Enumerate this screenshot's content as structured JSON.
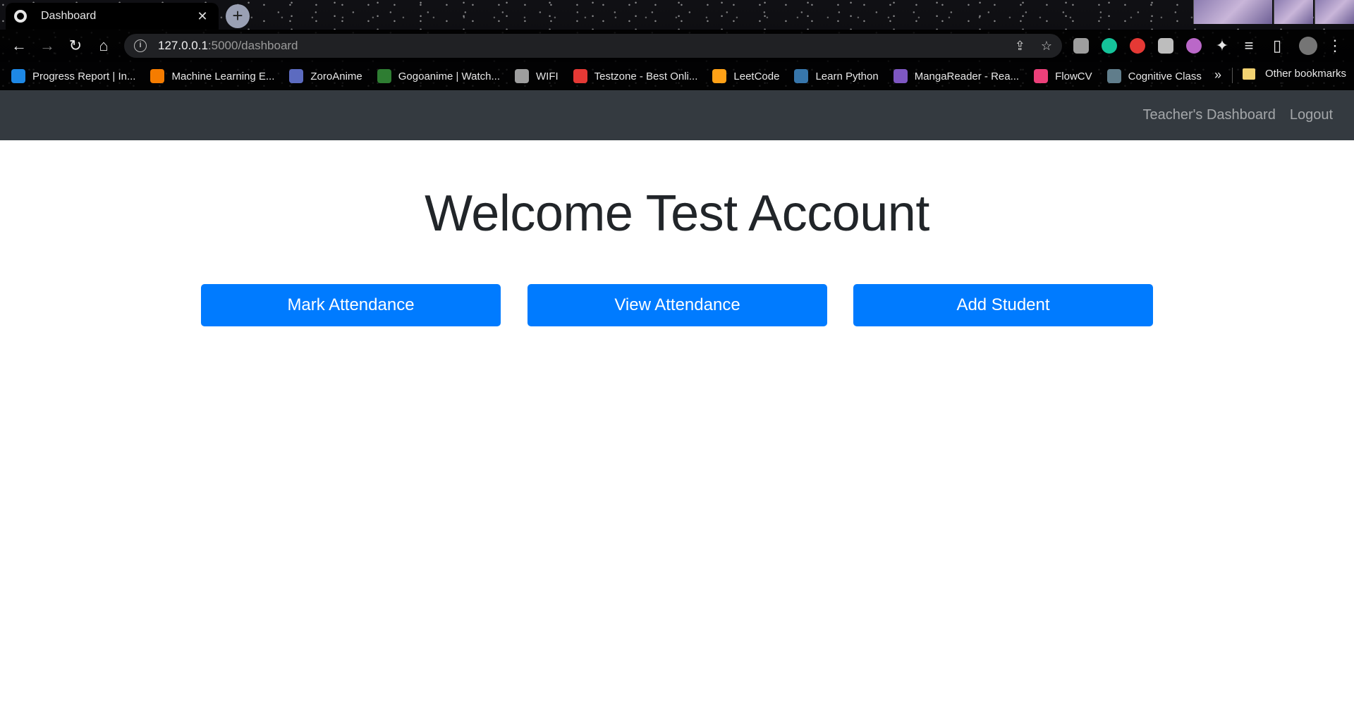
{
  "browser": {
    "tab_title": "Dashboard",
    "url_host": "127.0.0.1",
    "url_rest": ":5000/dashboard",
    "bookmarks": [
      {
        "label": "Progress Report | In...",
        "icon": "is-icon",
        "color": "#1e88e5"
      },
      {
        "label": "Machine Learning E...",
        "icon": "hexagon-icon",
        "color": "#f57c00"
      },
      {
        "label": "ZoroAnime",
        "icon": "zoro-icon",
        "color": "#5c6bc0"
      },
      {
        "label": "Gogoanime | Watch...",
        "icon": "gogo-icon",
        "color": "#2e7d32"
      },
      {
        "label": "WIFI",
        "icon": "globe-icon",
        "color": "#9e9e9e"
      },
      {
        "label": "Testzone - Best Onli...",
        "icon": "bug-icon",
        "color": "#e53935"
      },
      {
        "label": "LeetCode",
        "icon": "leetcode-icon",
        "color": "#ffa116"
      },
      {
        "label": "Learn Python",
        "icon": "python-icon",
        "color": "#3776ab"
      },
      {
        "label": "MangaReader - Rea...",
        "icon": "manga-icon",
        "color": "#7e57c2"
      },
      {
        "label": "FlowCV",
        "icon": "flowcv-icon",
        "color": "#ec407a"
      },
      {
        "label": "Cognitive Class",
        "icon": "cognitive-icon",
        "color": "#607d8b"
      }
    ],
    "more_bookmarks": "»",
    "other_bookmarks": "Other bookmarks"
  },
  "navbar": {
    "links": [
      "Teacher's Dashboard",
      "Logout"
    ]
  },
  "main": {
    "welcome": "Welcome Test Account",
    "buttons": [
      "Mark Attendance",
      "View Attendance",
      "Add Student"
    ]
  },
  "colors": {
    "navbar_bg": "#343a40",
    "primary": "#007bff",
    "heading": "#212529"
  }
}
